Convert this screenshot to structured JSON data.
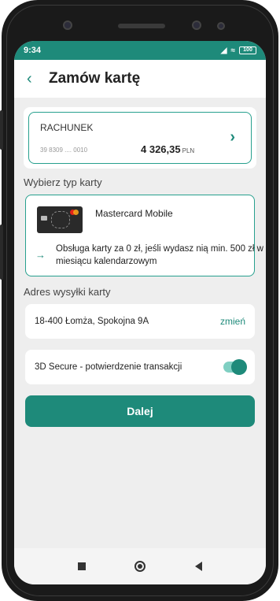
{
  "status_bar": {
    "time": "9:34",
    "signal": "⨆▏",
    "wifi": "◠",
    "battery": "100"
  },
  "header": {
    "back_icon": "chevron-left",
    "title": "Zamów kartę"
  },
  "account": {
    "label": "RACHUNEK",
    "number": "39 8309 .... 0010",
    "balance": "4 326,35",
    "currency": "PLN"
  },
  "card_type_section": {
    "label": "Wybierz typ karty",
    "card_name": "Mastercard Mobile",
    "info": "Obsługa karty za 0 zł, jeśli wydasz nią min. 500 zł w miesiącu kalendarzowym"
  },
  "address_section": {
    "label": "Adres wysyłki karty",
    "address": "18-400 Łomża, Spokojna 9A",
    "change_label": "zmień"
  },
  "secure": {
    "label": "3D Secure - potwierdzenie transakcji",
    "enabled": true
  },
  "primary_button": {
    "label": "Dalej"
  },
  "colors": {
    "accent": "#1e8a7a",
    "border_accent": "#27a08e",
    "background": "#eeeeee"
  }
}
